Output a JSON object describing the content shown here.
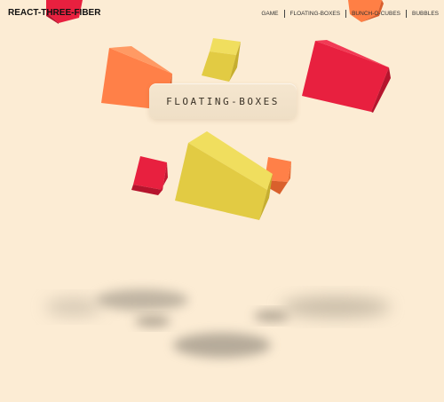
{
  "brand": {
    "title": "REACT-THREE-FIBER"
  },
  "nav": {
    "items": [
      {
        "label": "GAME"
      },
      {
        "label": "FLOATING-BOXES"
      },
      {
        "label": "BUNCH-O-CUBES"
      },
      {
        "label": "BUBBLES"
      }
    ]
  },
  "hero": {
    "label": "FLOATING-BOXES"
  },
  "colors": {
    "background": "#fcecd4",
    "red": "#e8203f",
    "orange": "#ff7f45",
    "yellow": "#e5cf4a"
  }
}
